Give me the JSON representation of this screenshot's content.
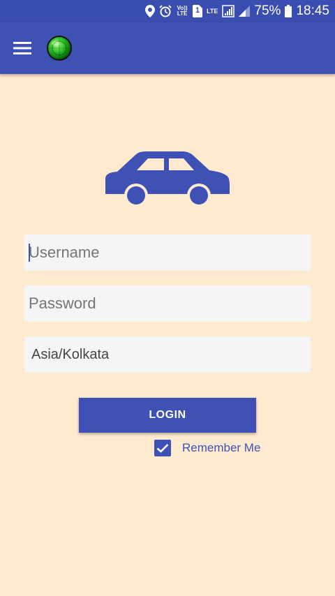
{
  "status_bar": {
    "battery_percent": "75%",
    "time": "18:45",
    "volte_tag": "Vo)) LTE",
    "sim_slot": "1",
    "lte_tag": "LTE"
  },
  "app_bar": {
    "menu_icon": "hamburger-menu-icon",
    "logo_icon": "green-radar-logo-icon"
  },
  "hero": {
    "icon": "car-icon"
  },
  "login_form": {
    "username_placeholder": "Username",
    "password_placeholder": "Password",
    "timezone_value": "Asia/Kolkata",
    "login_label": "LOGIN",
    "remember_me_label": "Remember Me",
    "remember_me_checked": true
  },
  "colors": {
    "primary": "#3f51b5",
    "status_bar": "#3a4db0",
    "background": "#feebcf",
    "field_background": "#f5f5f5"
  }
}
